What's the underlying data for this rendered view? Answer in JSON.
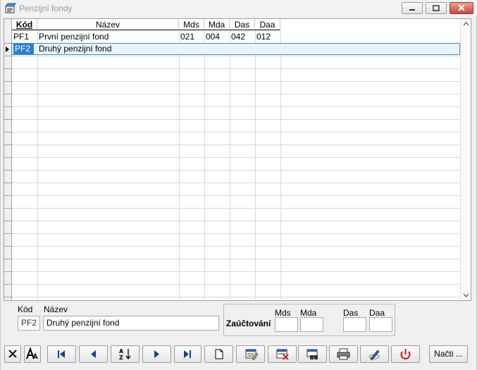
{
  "window": {
    "title": "Penzijní fondy"
  },
  "grid": {
    "columns": [
      {
        "label": "Kód",
        "key": "kod"
      },
      {
        "label": "Název",
        "key": "nazev"
      },
      {
        "label": "Mds",
        "key": "mds"
      },
      {
        "label": "Mda",
        "key": "mda"
      },
      {
        "label": "Das",
        "key": "das"
      },
      {
        "label": "Daa",
        "key": "daa"
      }
    ],
    "rows": [
      {
        "kod": "PF1",
        "nazev": "První penzijní fond",
        "mds": "021",
        "mda": "004",
        "das": "042",
        "daa": "012"
      },
      {
        "kod": "PF2",
        "nazev": "Druhý penzijní fond",
        "mds": "",
        "mda": "",
        "das": "",
        "daa": ""
      }
    ],
    "selected_row": 1
  },
  "detail": {
    "kod_label": "Kód",
    "nazev_label": "Název",
    "kod_value": "PF2",
    "nazev_value": "Druhý penzijní fond",
    "zauctovani_label": "Zaúčtování",
    "mds_label": "Mds",
    "mda_label": "Mda",
    "das_label": "Das",
    "daa_label": "Daa",
    "mds_value": "",
    "mda_value": "",
    "das_value": "",
    "daa_value": ""
  },
  "toolbar": {
    "buttons": [
      {
        "icon": "cancel-filter-icon"
      },
      {
        "icon": "font-icon"
      },
      {
        "icon": "first-record-icon"
      },
      {
        "icon": "previous-record-icon"
      },
      {
        "icon": "sort-az-icon"
      },
      {
        "icon": "next-record-icon"
      },
      {
        "icon": "last-record-icon"
      },
      {
        "icon": "new-record-icon"
      },
      {
        "icon": "edit-record-icon"
      },
      {
        "icon": "delete-record-icon"
      },
      {
        "icon": "find-icon"
      },
      {
        "icon": "print-icon"
      },
      {
        "icon": "tools-icon"
      },
      {
        "icon": "power-icon"
      }
    ],
    "nacti_label": "Načti ..."
  }
}
